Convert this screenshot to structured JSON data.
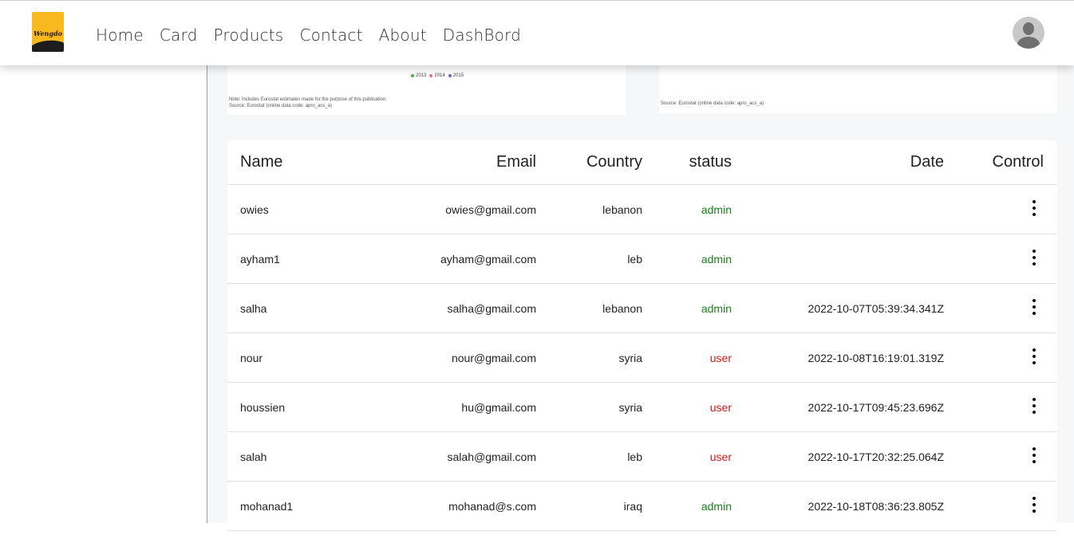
{
  "brand": {
    "logo_text": "Wengdo"
  },
  "nav": {
    "items": [
      {
        "label": "Home"
      },
      {
        "label": "Card"
      },
      {
        "label": "Products"
      },
      {
        "label": "Contact"
      },
      {
        "label": "About"
      },
      {
        "label": "DashBord"
      }
    ]
  },
  "charts": {
    "left": {
      "legend": [
        "2013",
        "2014",
        "2015"
      ],
      "legend_colors": [
        "#4caf50",
        "#e57373",
        "#5c6bc0"
      ],
      "note": "Note: includes Eurostat estimates made for the purpose of this publication.",
      "source": "Source: Eurostat (online data code: apro_acs_a)"
    },
    "right": {
      "source": "Source: Eurostat (online data code: apro_acs_a)"
    }
  },
  "table": {
    "headers": {
      "name": "Name",
      "email": "Email",
      "country": "Country",
      "status": "status",
      "date": "Date",
      "control": "Control"
    },
    "rows": [
      {
        "name": "owies",
        "email": "owies@gmail.com",
        "country": "lebanon",
        "status": "admin",
        "date": ""
      },
      {
        "name": "ayham1",
        "email": "ayham@gmail.com",
        "country": "leb",
        "status": "admin",
        "date": ""
      },
      {
        "name": "salha",
        "email": "salha@gmail.com",
        "country": "lebanon",
        "status": "admin",
        "date": "2022-10-07T05:39:34.341Z"
      },
      {
        "name": "nour",
        "email": "nour@gmail.com",
        "country": "syria",
        "status": "user",
        "date": "2022-10-08T16:19:01.319Z"
      },
      {
        "name": "houssien",
        "email": "hu@gmail.com",
        "country": "syria",
        "status": "user",
        "date": "2022-10-17T09:45:23.696Z"
      },
      {
        "name": "salah",
        "email": "salah@gmail.com",
        "country": "leb",
        "status": "user",
        "date": "2022-10-17T20:32:25.064Z"
      },
      {
        "name": "mohanad1",
        "email": "mohanad@s.com",
        "country": "iraq",
        "status": "admin",
        "date": "2022-10-18T08:36:23.805Z"
      }
    ]
  },
  "colors": {
    "admin": "#1a7f1a",
    "user": "#e01515",
    "logo": "#f7b91e"
  }
}
